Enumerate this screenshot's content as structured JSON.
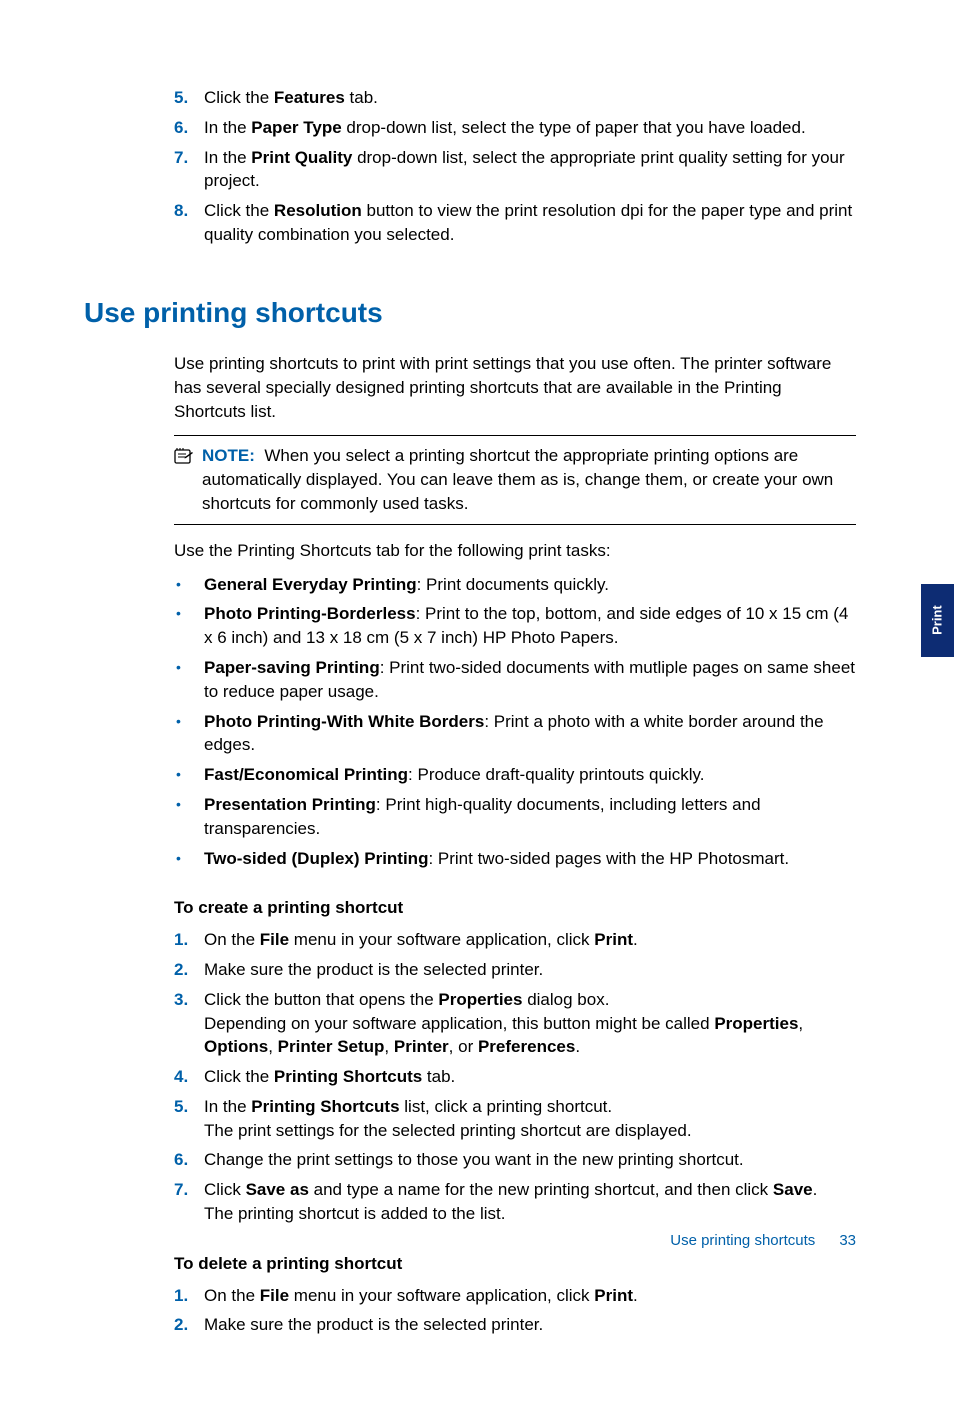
{
  "top_ol": [
    {
      "num": "5.",
      "html": "Click the <b>Features</b> tab."
    },
    {
      "num": "6.",
      "html": "In the <b>Paper Type</b> drop-down list, select the type of paper that you have loaded."
    },
    {
      "num": "7.",
      "html": "In the <b>Print Quality</b> drop-down list, select the appropriate print quality setting for your project."
    },
    {
      "num": "8.",
      "html": "Click the <b>Resolution</b> button to view the print resolution dpi for the paper type and print quality combination you selected."
    }
  ],
  "h1": "Use printing shortcuts",
  "intro": "Use printing shortcuts to print with print settings that you use often. The printer software has several specially designed printing shortcuts that are available in the Printing Shortcuts list.",
  "note_label": "NOTE:",
  "note_text": "When you select a printing shortcut the appropriate printing options are automatically displayed. You can leave them as is, change them, or create your own shortcuts for commonly used tasks.",
  "tasks_intro": "Use the Printing Shortcuts tab for the following print tasks:",
  "tasks": [
    {
      "html": "<b>General Everyday Printing</b>: Print documents quickly."
    },
    {
      "html": "<b>Photo Printing-Borderless</b>: Print to the top, bottom, and side edges of 10 x 15 cm (4 x 6 inch) and 13 x 18 cm (5 x 7 inch) HP Photo Papers."
    },
    {
      "html": "<b>Paper-saving Printing</b>: Print two-sided documents with mutliple pages on same sheet to reduce paper usage."
    },
    {
      "html": "<b>Photo Printing-With White Borders</b>: Print a photo with a white border around the edges."
    },
    {
      "html": "<b>Fast/Economical Printing</b>: Produce draft-quality printouts quickly."
    },
    {
      "html": "<b>Presentation Printing</b>: Print high-quality documents, including letters and transparencies."
    },
    {
      "html": "<b>Two-sided (Duplex) Printing</b>: Print two-sided pages with the HP Photosmart."
    }
  ],
  "create_h": "To create a printing shortcut",
  "create_ol": [
    {
      "num": "1.",
      "html": "On the <b>File</b> menu in your software application, click <b>Print</b>."
    },
    {
      "num": "2.",
      "html": "Make sure the product is the selected printer."
    },
    {
      "num": "3.",
      "html": "Click the button that opens the <b>Properties</b> dialog box.<br>Depending on your software application, this button might be called <b>Properties</b>, <b>Options</b>, <b>Printer Setup</b>, <b>Printer</b>, or <b>Preferences</b>."
    },
    {
      "num": "4.",
      "html": "Click the <b>Printing Shortcuts</b> tab."
    },
    {
      "num": "5.",
      "html": "In the <b>Printing Shortcuts</b> list, click a printing shortcut.<br>The print settings for the selected printing shortcut are displayed."
    },
    {
      "num": "6.",
      "html": "Change the print settings to those you want in the new printing shortcut."
    },
    {
      "num": "7.",
      "html": "Click <b>Save as</b> and type a name for the new printing shortcut, and then click <b>Save</b>.<br>The printing shortcut is added to the list."
    }
  ],
  "delete_h": "To delete a printing shortcut",
  "delete_ol": [
    {
      "num": "1.",
      "html": "On the <b>File</b> menu in your software application, click <b>Print</b>."
    },
    {
      "num": "2.",
      "html": "Make sure the product is the selected printer."
    }
  ],
  "side_tab": "Print",
  "footer_link": "Use printing shortcuts",
  "footer_page": "33"
}
